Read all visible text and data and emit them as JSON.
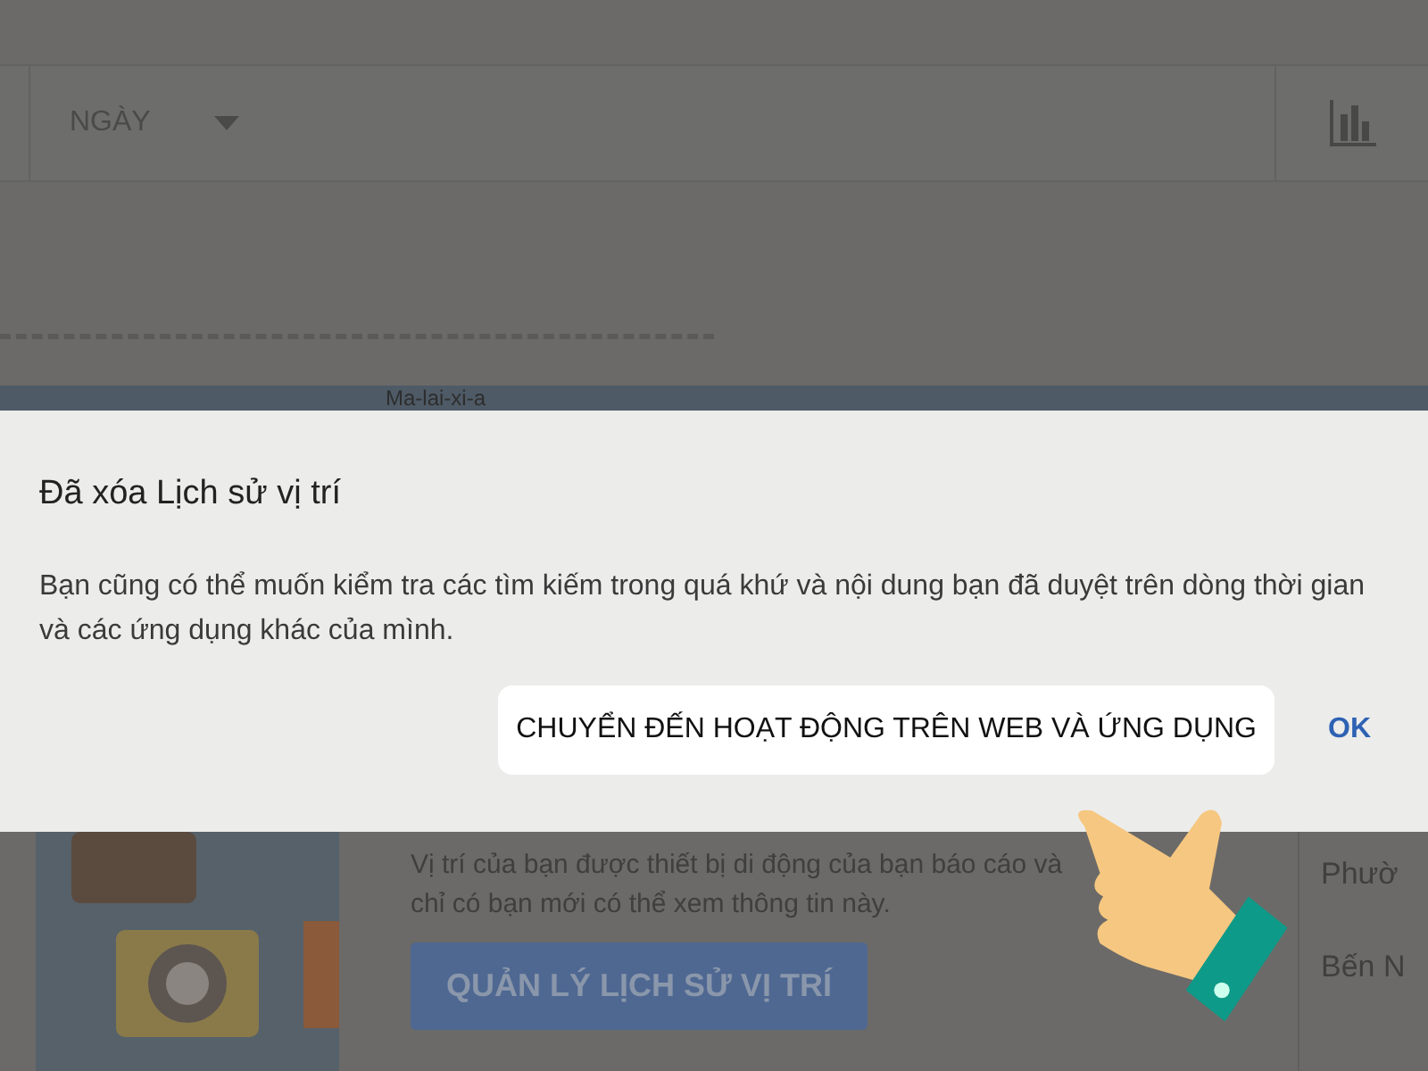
{
  "toolbar": {
    "period": "NGÀY"
  },
  "map": {
    "label": "Ma-lai-xi-a"
  },
  "dialog": {
    "title": "Đã xóa Lịch sử vị trí",
    "body": "Bạn cũng có thể muốn kiểm tra các tìm kiếm trong quá khứ và nội dung bạn đã duyệt trên dòng thời gian và các ứng dụng khác của mình.",
    "buttons": [
      {
        "label": "CHUYỂN ĐẾN HOẠT ĐỘNG TRÊN WEB VÀ ỨNG DỤNG",
        "highlighted": true
      },
      {
        "label": "OK",
        "highlighted": false
      }
    ]
  },
  "background": {
    "description": "Vị trí của bạn được thiết bị di động của bạn báo cáo và chỉ có bạn mới có thể xem thông tin này.",
    "button": "QUẢN LÝ LỊCH SỬ VỊ TRÍ",
    "places": [
      "Phườ",
      "Bến N"
    ]
  }
}
